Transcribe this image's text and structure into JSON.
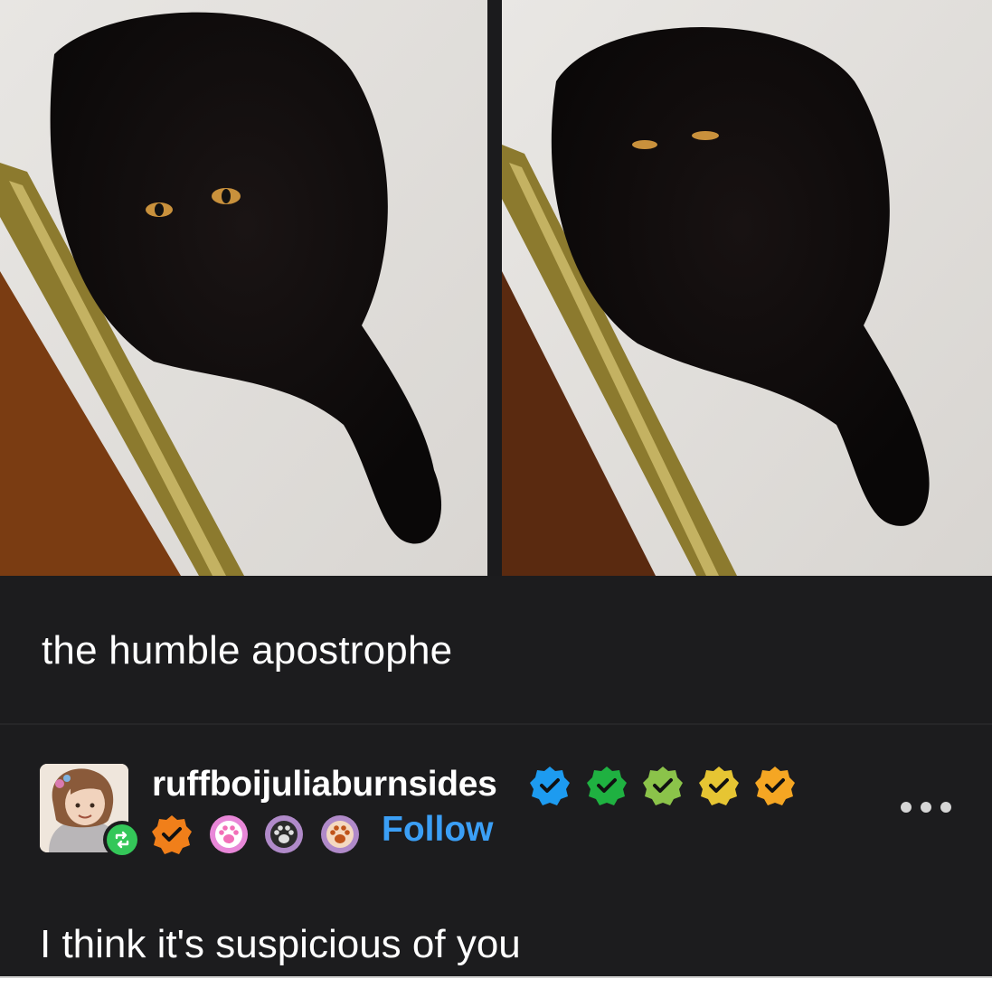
{
  "post": {
    "caption": "the humble apostrophe",
    "images": [
      {
        "name": "black-cat-photo-1"
      },
      {
        "name": "black-cat-photo-2"
      }
    ]
  },
  "reblog": {
    "username": "ruffboijuliaburnsides",
    "follow_label": "Follow",
    "badges": [
      {
        "icon": "check-badge-icon",
        "color": "#1d9bf0"
      },
      {
        "icon": "check-badge-icon",
        "color": "#1fb141"
      },
      {
        "icon": "check-badge-icon",
        "color": "#8bc34a"
      },
      {
        "icon": "check-badge-icon",
        "color": "#e6c533"
      },
      {
        "icon": "check-badge-icon",
        "color": "#f5a623"
      },
      {
        "icon": "check-badge-icon",
        "color": "#f07f1a"
      },
      {
        "icon": "paw-badge-icon",
        "color": "#e887d8"
      },
      {
        "icon": "paw-badge-icon",
        "color": "#2b2b2b"
      },
      {
        "icon": "paw-badge-icon",
        "color": "#c0541a"
      }
    ],
    "reply_text": "I think it's suspicious of you"
  },
  "colors": {
    "background": "#1c1c1e",
    "follow": "#3b9ff6",
    "reblog": "#34c759"
  }
}
